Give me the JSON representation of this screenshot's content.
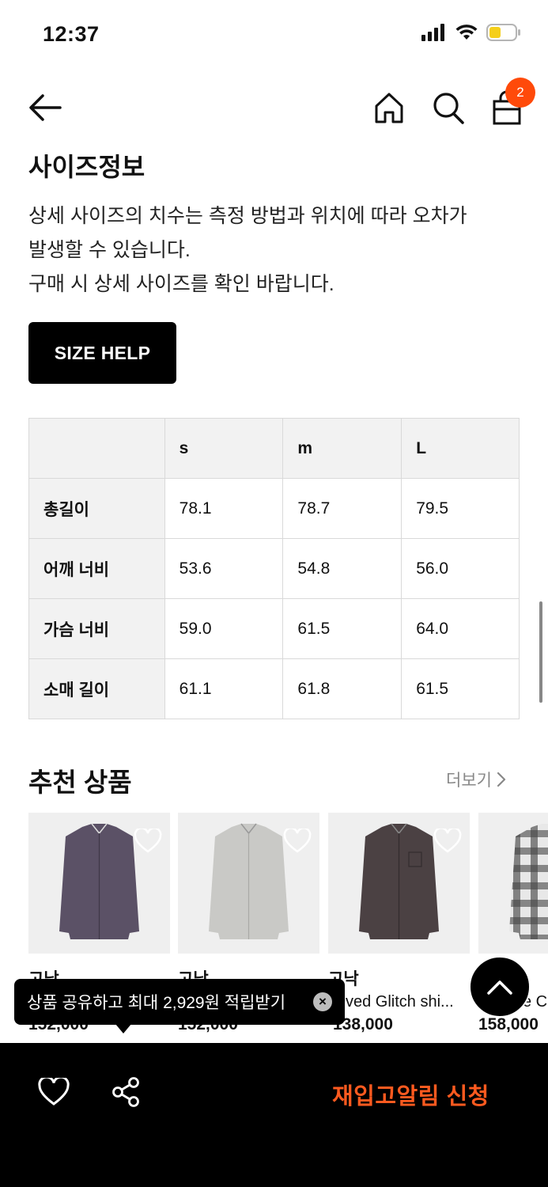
{
  "status_bar": {
    "time": "12:37"
  },
  "nav": {
    "cart_count": "2"
  },
  "size_info": {
    "title": "사이즈정보",
    "desc_lines": [
      "상세 사이즈의 치수는 측정 방법과 위치에 따라 오차가",
      "발생할 수 있습니다.",
      "구매 시 상세 사이즈를 확인 바랍니다."
    ],
    "size_help_label": "SIZE HELP"
  },
  "size_table": {
    "headers": [
      "",
      "s",
      "m",
      "L"
    ],
    "rows": [
      {
        "label": "총길이",
        "values": [
          "78.1",
          "78.7",
          "79.5"
        ]
      },
      {
        "label": "어깨 너비",
        "values": [
          "53.6",
          "54.8",
          "56.0"
        ]
      },
      {
        "label": "가슴 너비",
        "values": [
          "59.0",
          "61.5",
          "64.0"
        ]
      },
      {
        "label": "소매 길이",
        "values": [
          "61.1",
          "61.8",
          "61.5"
        ]
      }
    ]
  },
  "recommended": {
    "title": "추천 상품",
    "more_label": "더보기",
    "products": [
      {
        "brand": "고낙",
        "name": "",
        "price": "152,000",
        "shirt_color": "#5b5166"
      },
      {
        "brand": "고낙",
        "name": "",
        "price": "152,000",
        "shirt_color": "#c9c9c6"
      },
      {
        "brand": "고낙",
        "name": "ved Glitch shi...",
        "price": "138,000",
        "shirt_color": "#4b4143"
      },
      {
        "brand": "",
        "name": "e Cl",
        "price": "158,000",
        "shirt_color": "#9a9a9a"
      }
    ]
  },
  "tooltip": {
    "text": "상품 공유하고 최대 2,929원 적립받기"
  },
  "bottom_bar": {
    "restock_label": "재입고알림 신청"
  },
  "colors": {
    "accent": "#ff4a0a",
    "restock": "#ff5a1f",
    "dark": "#000000",
    "table_header_bg": "#f2f2f2"
  }
}
